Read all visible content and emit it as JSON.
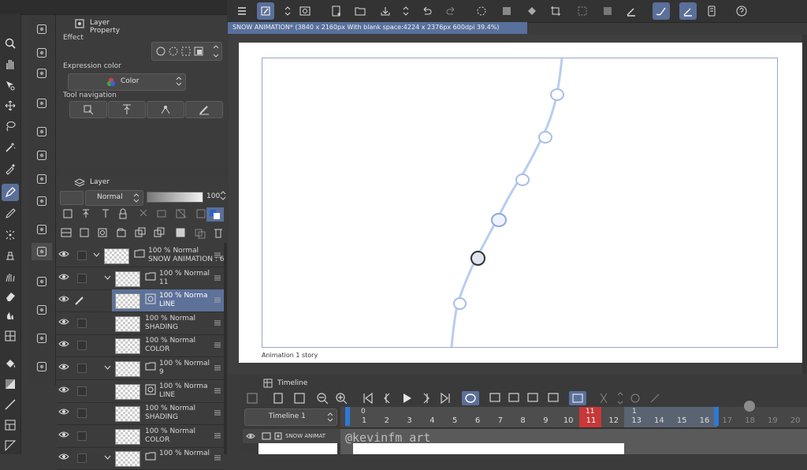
{
  "top_toolbar_icons": [
    "menu-icon",
    "draw-icon",
    "updown-icon",
    "eye-icon",
    "new-icon",
    "open-icon",
    "save-icon",
    "updown-icon",
    "undo-icon",
    "redo-icon",
    "loading-icon",
    "erase-icon",
    "fill-icon",
    "transform-icon",
    "selection-icon",
    "selection2-icon",
    "pen-icon",
    "brush-icon",
    "pen2-icon",
    "device-icon",
    "help-icon"
  ],
  "document_tab": "SNOW ANIMATION* (3840 x 2160px With blank space:4224 x 2376px 600dpi 39.4%)",
  "canvas": {
    "label": "Animation 1 story"
  },
  "layer_property": {
    "title": "Layer Property",
    "effect_label": "Effect",
    "expression_color_label": "Expression color",
    "expression_color_value": "Color",
    "tool_navigation_label": "Tool navigation"
  },
  "layer_panel": {
    "title": "Layer",
    "blend_mode": "Normal",
    "opacity": "100"
  },
  "layers": [
    {
      "line1": "100 %  Normal",
      "line2": "SNOW ANIMATION : 6",
      "type": "folder",
      "indent": 0
    },
    {
      "line1": "100 %  Normal",
      "line2": "11",
      "type": "folder",
      "indent": 1
    },
    {
      "line1": "100 %  Norma",
      "line2": "LINE",
      "type": "vector",
      "indent": 2,
      "selected": true
    },
    {
      "line1": "100 %  Normal",
      "line2": "SHADING",
      "type": "raster",
      "indent": 2
    },
    {
      "line1": "100 %  Normal",
      "line2": "COLOR",
      "type": "raster",
      "indent": 2
    },
    {
      "line1": "100 %  Normal",
      "line2": "9",
      "type": "folder",
      "indent": 1
    },
    {
      "line1": "100 %  Norma",
      "line2": "LINE",
      "type": "vector",
      "indent": 2
    },
    {
      "line1": "100 %  Normal",
      "line2": "SHADING",
      "type": "raster",
      "indent": 2
    },
    {
      "line1": "100 %  Normal",
      "line2": "COLOR",
      "type": "raster",
      "indent": 2
    },
    {
      "line1": "100 %  Normal",
      "line2": "",
      "type": "folder",
      "indent": 1
    }
  ],
  "timeline": {
    "title": "Timeline",
    "name": "Timeline 1",
    "track_name": "SNOW ANIMAT",
    "frames": [
      "1",
      "2",
      "3",
      "4",
      "5",
      "6",
      "7",
      "8",
      "9",
      "10",
      "11",
      "12",
      "13",
      "14",
      "15",
      "16",
      "17",
      "18",
      "19",
      "20"
    ],
    "marker_start": "0",
    "current_frame": "11",
    "end_marker": "1"
  },
  "watermark": "@kevinfm_art"
}
